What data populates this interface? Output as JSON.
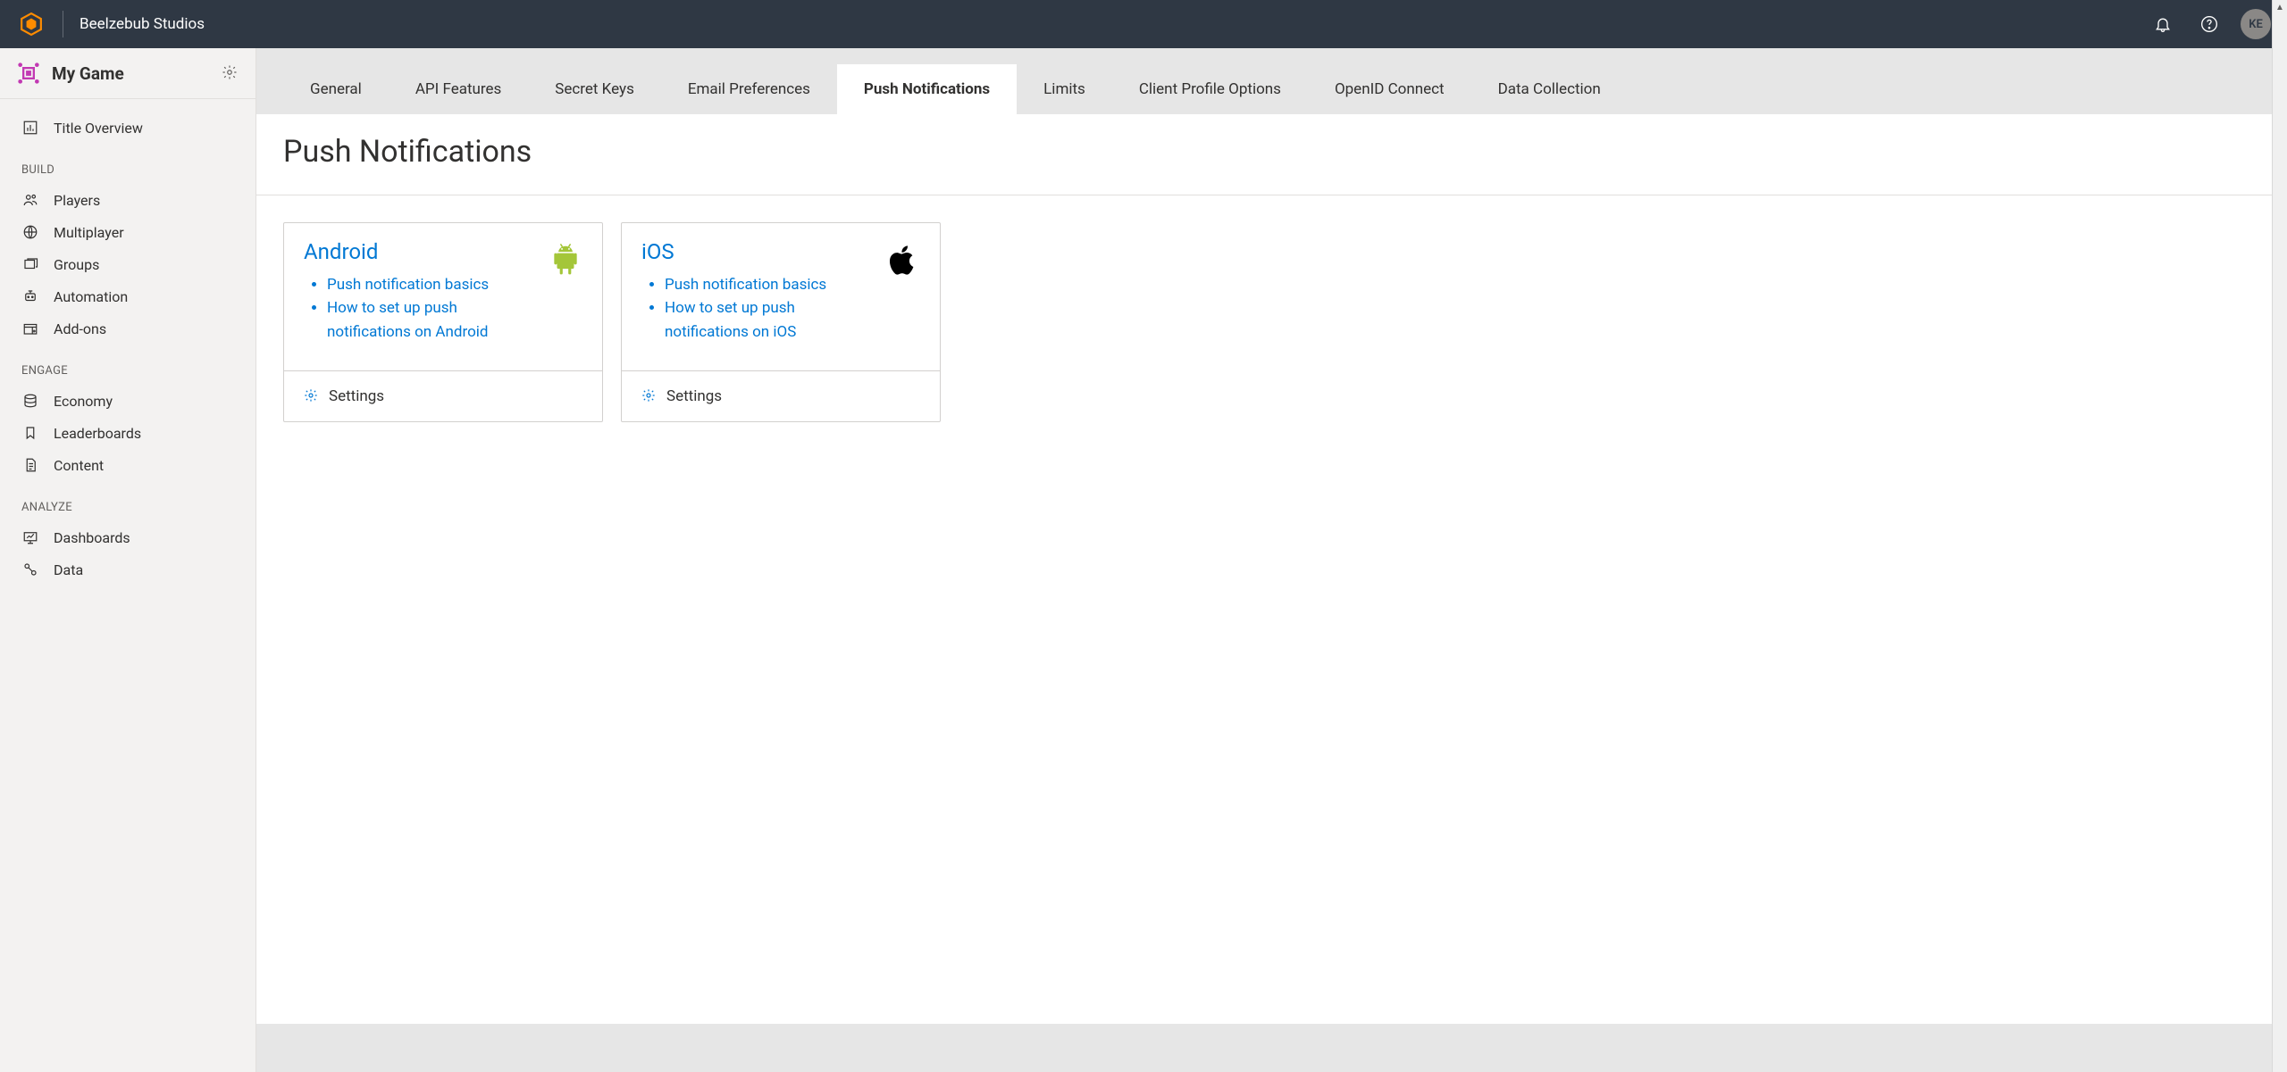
{
  "header": {
    "studio": "Beelzebub Studios",
    "user_initials": "KE"
  },
  "sidebar": {
    "game_title": "My Game",
    "top_item": "Title Overview",
    "sections": [
      {
        "label": "BUILD",
        "items": [
          "Players",
          "Multiplayer",
          "Groups",
          "Automation",
          "Add-ons"
        ]
      },
      {
        "label": "ENGAGE",
        "items": [
          "Economy",
          "Leaderboards",
          "Content"
        ]
      },
      {
        "label": "ANALYZE",
        "items": [
          "Dashboards",
          "Data"
        ]
      }
    ]
  },
  "tabs": [
    "General",
    "API Features",
    "Secret Keys",
    "Email Preferences",
    "Push Notifications",
    "Limits",
    "Client Profile Options",
    "OpenID Connect",
    "Data Collection"
  ],
  "active_tab": "Push Notifications",
  "page_title": "Push Notifications",
  "cards": [
    {
      "name": "android",
      "title": "Android",
      "links": [
        "Push notification basics",
        "How to set up push notifications on Android"
      ],
      "footer": "Settings"
    },
    {
      "name": "ios",
      "title": "iOS",
      "links": [
        "Push notification basics",
        "How to set up push notifications on iOS"
      ],
      "footer": "Settings"
    }
  ]
}
